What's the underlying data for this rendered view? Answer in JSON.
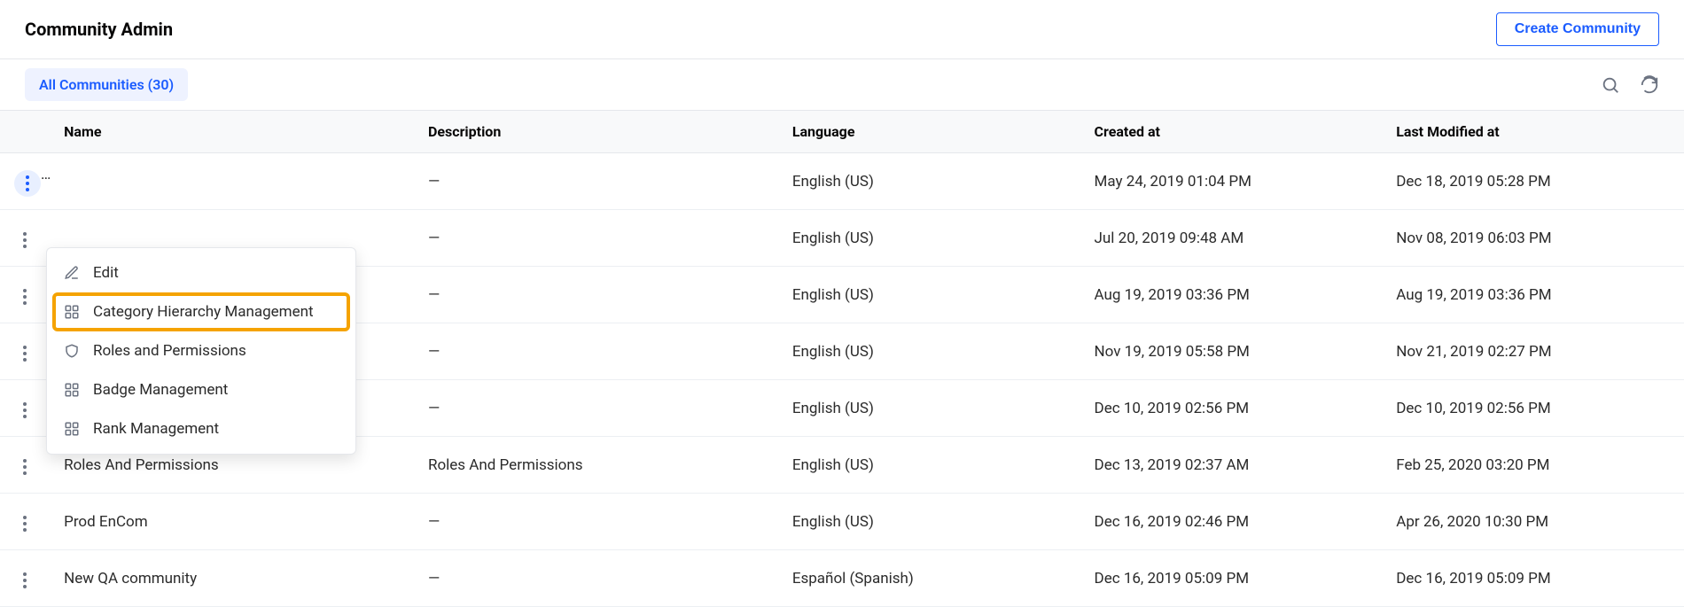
{
  "header": {
    "title": "Community Admin",
    "create_button": "Create Community"
  },
  "filter": {
    "all_label": "All Communities (30)"
  },
  "columns": {
    "name": "Name",
    "description": "Description",
    "language": "Language",
    "created": "Created at",
    "modified": "Last Modified at"
  },
  "menu": {
    "edit": "Edit",
    "category_hierarchy": "Category Hierarchy Management",
    "roles_permissions": "Roles and Permissions",
    "badge_mgmt": "Badge Management",
    "rank_mgmt": "Rank Management"
  },
  "rows": [
    {
      "name": "",
      "description": "—",
      "language": "English (US)",
      "created": "May 24, 2019 01:04 PM",
      "modified": "Dec 18, 2019 05:28 PM"
    },
    {
      "name": "",
      "description": "—",
      "language": "English (US)",
      "created": "Jul 20, 2019 09:48 AM",
      "modified": "Nov 08, 2019 06:03 PM"
    },
    {
      "name": "",
      "description": "—",
      "language": "English (US)",
      "created": "Aug 19, 2019 03:36 PM",
      "modified": "Aug 19, 2019 03:36 PM"
    },
    {
      "name": "",
      "description": "—",
      "language": "English (US)",
      "created": "Nov 19, 2019 05:58 PM",
      "modified": "Nov 21, 2019 02:27 PM"
    },
    {
      "name": "",
      "description": "—",
      "language": "English (US)",
      "created": "Dec 10, 2019 02:56 PM",
      "modified": "Dec 10, 2019 02:56 PM"
    },
    {
      "name": "Roles And Permissions",
      "description": "Roles And Permissions",
      "language": "English (US)",
      "created": "Dec 13, 2019 02:37 AM",
      "modified": "Feb 25, 2020 03:20 PM"
    },
    {
      "name": "Prod EnCom",
      "description": "—",
      "language": "English (US)",
      "created": "Dec 16, 2019 02:46 PM",
      "modified": "Apr 26, 2020 10:30 PM"
    },
    {
      "name": "New QA community",
      "description": "—",
      "language": "Español (Spanish)",
      "created": "Dec 16, 2019 05:09 PM",
      "modified": "Dec 16, 2019 05:09 PM"
    }
  ]
}
